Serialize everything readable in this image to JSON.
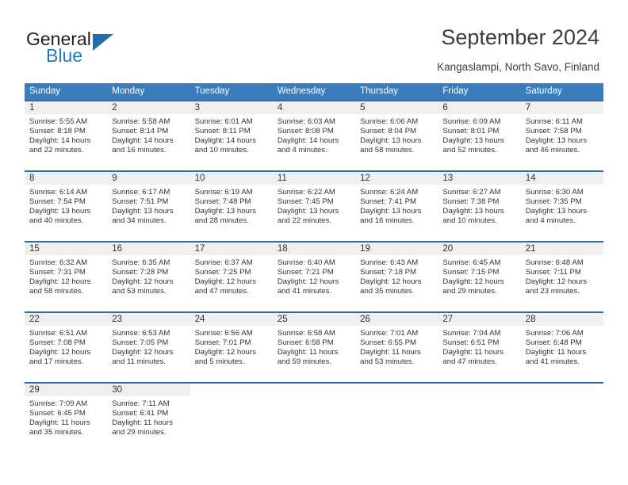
{
  "brand": {
    "name_top": "General",
    "name_bottom": "Blue",
    "accent_color": "#1f6cb0",
    "logo_icon": "triangle-logo-icon"
  },
  "header": {
    "title": "September 2024",
    "location": "Kangaslampi, North Savo, Finland"
  },
  "calendar": {
    "header_bg": "#3b7cbd",
    "daynum_band_bg": "#efefef",
    "cell_border_color": "#2c6ca8",
    "weekdays": [
      "Sunday",
      "Monday",
      "Tuesday",
      "Wednesday",
      "Thursday",
      "Friday",
      "Saturday"
    ],
    "weeks": [
      [
        {
          "day": "1",
          "sunrise": "Sunrise: 5:55 AM",
          "sunset": "Sunset: 8:18 PM",
          "daylight_1": "Daylight: 14 hours",
          "daylight_2": "and 22 minutes."
        },
        {
          "day": "2",
          "sunrise": "Sunrise: 5:58 AM",
          "sunset": "Sunset: 8:14 PM",
          "daylight_1": "Daylight: 14 hours",
          "daylight_2": "and 16 minutes."
        },
        {
          "day": "3",
          "sunrise": "Sunrise: 6:01 AM",
          "sunset": "Sunset: 8:11 PM",
          "daylight_1": "Daylight: 14 hours",
          "daylight_2": "and 10 minutes."
        },
        {
          "day": "4",
          "sunrise": "Sunrise: 6:03 AM",
          "sunset": "Sunset: 8:08 PM",
          "daylight_1": "Daylight: 14 hours",
          "daylight_2": "and 4 minutes."
        },
        {
          "day": "5",
          "sunrise": "Sunrise: 6:06 AM",
          "sunset": "Sunset: 8:04 PM",
          "daylight_1": "Daylight: 13 hours",
          "daylight_2": "and 58 minutes."
        },
        {
          "day": "6",
          "sunrise": "Sunrise: 6:09 AM",
          "sunset": "Sunset: 8:01 PM",
          "daylight_1": "Daylight: 13 hours",
          "daylight_2": "and 52 minutes."
        },
        {
          "day": "7",
          "sunrise": "Sunrise: 6:11 AM",
          "sunset": "Sunset: 7:58 PM",
          "daylight_1": "Daylight: 13 hours",
          "daylight_2": "and 46 minutes."
        }
      ],
      [
        {
          "day": "8",
          "sunrise": "Sunrise: 6:14 AM",
          "sunset": "Sunset: 7:54 PM",
          "daylight_1": "Daylight: 13 hours",
          "daylight_2": "and 40 minutes."
        },
        {
          "day": "9",
          "sunrise": "Sunrise: 6:17 AM",
          "sunset": "Sunset: 7:51 PM",
          "daylight_1": "Daylight: 13 hours",
          "daylight_2": "and 34 minutes."
        },
        {
          "day": "10",
          "sunrise": "Sunrise: 6:19 AM",
          "sunset": "Sunset: 7:48 PM",
          "daylight_1": "Daylight: 13 hours",
          "daylight_2": "and 28 minutes."
        },
        {
          "day": "11",
          "sunrise": "Sunrise: 6:22 AM",
          "sunset": "Sunset: 7:45 PM",
          "daylight_1": "Daylight: 13 hours",
          "daylight_2": "and 22 minutes."
        },
        {
          "day": "12",
          "sunrise": "Sunrise: 6:24 AM",
          "sunset": "Sunset: 7:41 PM",
          "daylight_1": "Daylight: 13 hours",
          "daylight_2": "and 16 minutes."
        },
        {
          "day": "13",
          "sunrise": "Sunrise: 6:27 AM",
          "sunset": "Sunset: 7:38 PM",
          "daylight_1": "Daylight: 13 hours",
          "daylight_2": "and 10 minutes."
        },
        {
          "day": "14",
          "sunrise": "Sunrise: 6:30 AM",
          "sunset": "Sunset: 7:35 PM",
          "daylight_1": "Daylight: 13 hours",
          "daylight_2": "and 4 minutes."
        }
      ],
      [
        {
          "day": "15",
          "sunrise": "Sunrise: 6:32 AM",
          "sunset": "Sunset: 7:31 PM",
          "daylight_1": "Daylight: 12 hours",
          "daylight_2": "and 58 minutes."
        },
        {
          "day": "16",
          "sunrise": "Sunrise: 6:35 AM",
          "sunset": "Sunset: 7:28 PM",
          "daylight_1": "Daylight: 12 hours",
          "daylight_2": "and 53 minutes."
        },
        {
          "day": "17",
          "sunrise": "Sunrise: 6:37 AM",
          "sunset": "Sunset: 7:25 PM",
          "daylight_1": "Daylight: 12 hours",
          "daylight_2": "and 47 minutes."
        },
        {
          "day": "18",
          "sunrise": "Sunrise: 6:40 AM",
          "sunset": "Sunset: 7:21 PM",
          "daylight_1": "Daylight: 12 hours",
          "daylight_2": "and 41 minutes."
        },
        {
          "day": "19",
          "sunrise": "Sunrise: 6:43 AM",
          "sunset": "Sunset: 7:18 PM",
          "daylight_1": "Daylight: 12 hours",
          "daylight_2": "and 35 minutes."
        },
        {
          "day": "20",
          "sunrise": "Sunrise: 6:45 AM",
          "sunset": "Sunset: 7:15 PM",
          "daylight_1": "Daylight: 12 hours",
          "daylight_2": "and 29 minutes."
        },
        {
          "day": "21",
          "sunrise": "Sunrise: 6:48 AM",
          "sunset": "Sunset: 7:11 PM",
          "daylight_1": "Daylight: 12 hours",
          "daylight_2": "and 23 minutes."
        }
      ],
      [
        {
          "day": "22",
          "sunrise": "Sunrise: 6:51 AM",
          "sunset": "Sunset: 7:08 PM",
          "daylight_1": "Daylight: 12 hours",
          "daylight_2": "and 17 minutes."
        },
        {
          "day": "23",
          "sunrise": "Sunrise: 6:53 AM",
          "sunset": "Sunset: 7:05 PM",
          "daylight_1": "Daylight: 12 hours",
          "daylight_2": "and 11 minutes."
        },
        {
          "day": "24",
          "sunrise": "Sunrise: 6:56 AM",
          "sunset": "Sunset: 7:01 PM",
          "daylight_1": "Daylight: 12 hours",
          "daylight_2": "and 5 minutes."
        },
        {
          "day": "25",
          "sunrise": "Sunrise: 6:58 AM",
          "sunset": "Sunset: 6:58 PM",
          "daylight_1": "Daylight: 11 hours",
          "daylight_2": "and 59 minutes."
        },
        {
          "day": "26",
          "sunrise": "Sunrise: 7:01 AM",
          "sunset": "Sunset: 6:55 PM",
          "daylight_1": "Daylight: 11 hours",
          "daylight_2": "and 53 minutes."
        },
        {
          "day": "27",
          "sunrise": "Sunrise: 7:04 AM",
          "sunset": "Sunset: 6:51 PM",
          "daylight_1": "Daylight: 11 hours",
          "daylight_2": "and 47 minutes."
        },
        {
          "day": "28",
          "sunrise": "Sunrise: 7:06 AM",
          "sunset": "Sunset: 6:48 PM",
          "daylight_1": "Daylight: 11 hours",
          "daylight_2": "and 41 minutes."
        }
      ],
      [
        {
          "day": "29",
          "sunrise": "Sunrise: 7:09 AM",
          "sunset": "Sunset: 6:45 PM",
          "daylight_1": "Daylight: 11 hours",
          "daylight_2": "and 35 minutes."
        },
        {
          "day": "30",
          "sunrise": "Sunrise: 7:11 AM",
          "sunset": "Sunset: 6:41 PM",
          "daylight_1": "Daylight: 11 hours",
          "daylight_2": "and 29 minutes."
        },
        {
          "day": "",
          "sunrise": "",
          "sunset": "",
          "daylight_1": "",
          "daylight_2": ""
        },
        {
          "day": "",
          "sunrise": "",
          "sunset": "",
          "daylight_1": "",
          "daylight_2": ""
        },
        {
          "day": "",
          "sunrise": "",
          "sunset": "",
          "daylight_1": "",
          "daylight_2": ""
        },
        {
          "day": "",
          "sunrise": "",
          "sunset": "",
          "daylight_1": "",
          "daylight_2": ""
        },
        {
          "day": "",
          "sunrise": "",
          "sunset": "",
          "daylight_1": "",
          "daylight_2": ""
        }
      ]
    ]
  }
}
